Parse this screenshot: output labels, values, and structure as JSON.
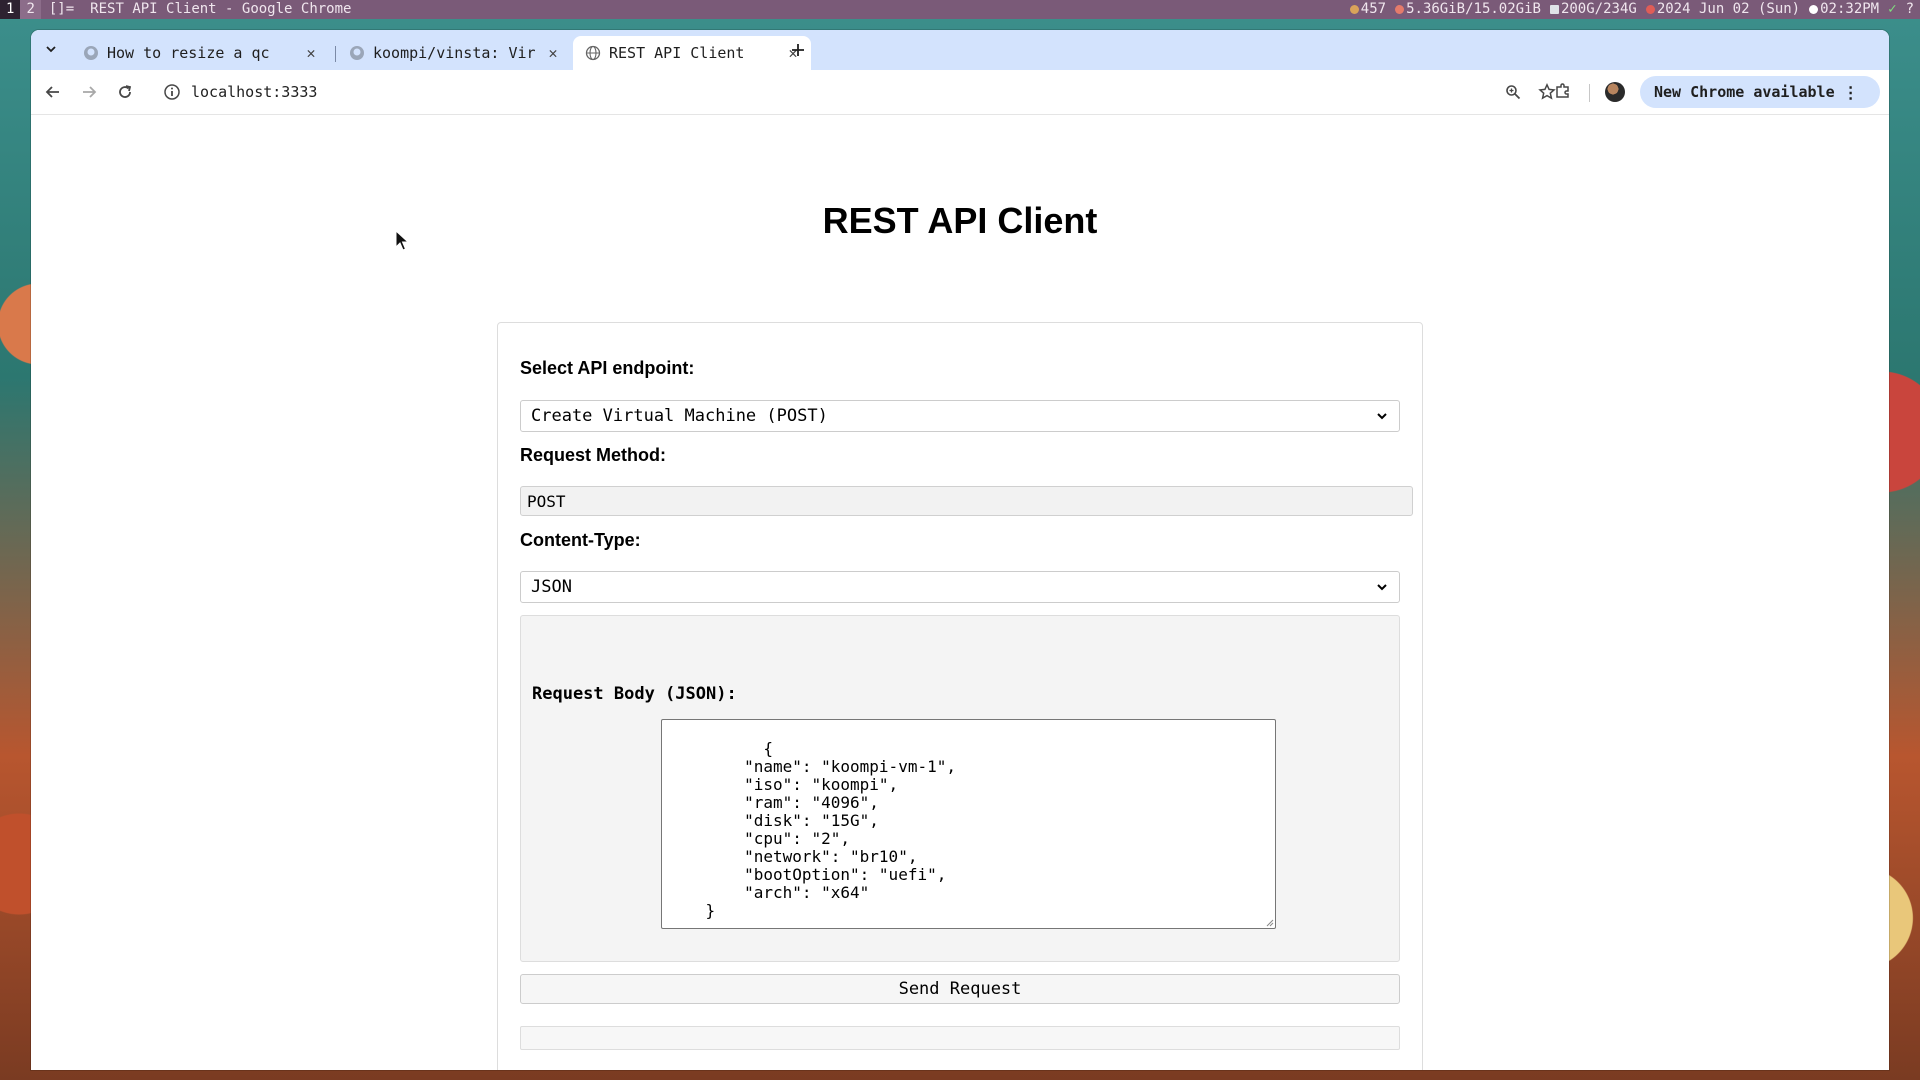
{
  "statusbar": {
    "workspace_active": "1",
    "workspace_inactive": "2",
    "layout": "[]=",
    "window_title": "REST API Client - Google Chrome",
    "indicators": {
      "updates": "457",
      "memory": "5.36GiB/15.02GiB",
      "disk": "200G/234G",
      "date": "2024 Jun 02 (Sun)",
      "time": "02:32PM",
      "check": "✓",
      "extra": "?"
    }
  },
  "browser": {
    "tabs": [
      {
        "label": "How to resize a qc",
        "icon": "github-icon"
      },
      {
        "label": "koompi/vinsta: Vir",
        "icon": "github-icon"
      },
      {
        "label": "REST API Client",
        "icon": "globe-icon",
        "active": true
      }
    ],
    "url": "localhost:3333",
    "update_label": "New Chrome available"
  },
  "page": {
    "title": "REST API Client",
    "endpoint_label": "Select API endpoint:",
    "endpoint_value": "Create Virtual Machine (POST)",
    "method_label": "Request Method:",
    "method_value": "POST",
    "content_type_label": "Content-Type:",
    "content_type_value": "JSON",
    "body_label": "Request Body (JSON):",
    "body_value": "{\n        \"name\": \"koompi-vm-1\",\n        \"iso\": \"koompi\",\n        \"ram\": \"4096\",\n        \"disk\": \"15G\",\n        \"cpu\": \"2\",\n        \"network\": \"br10\",\n        \"bootOption\": \"uefi\",\n        \"arch\": \"x64\"\n    }",
    "send_label": "Send Request",
    "response_value": ""
  },
  "colors": {
    "statusbar_bg": "#7a5a78",
    "tabstrip_bg": "#d3e3fd",
    "update_btn_bg": "#d3e3fd"
  }
}
